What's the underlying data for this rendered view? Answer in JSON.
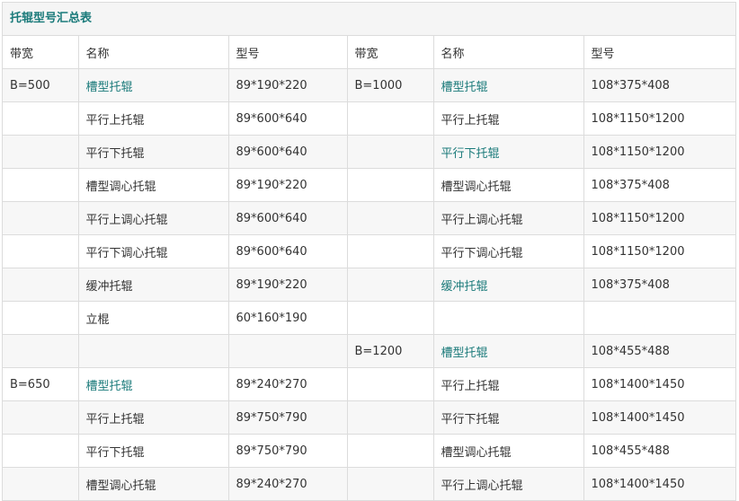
{
  "title": "托辊型号汇总表",
  "headers": [
    "带宽",
    "名称",
    "型号",
    "带宽",
    "名称",
    "型号"
  ],
  "rows": [
    [
      {
        "t": "B=500"
      },
      {
        "t": "槽型托辊",
        "link": true
      },
      {
        "t": "89*190*220"
      },
      {
        "t": "B=1000"
      },
      {
        "t": "槽型托辊",
        "link": true
      },
      {
        "t": "108*375*408"
      }
    ],
    [
      {
        "t": ""
      },
      {
        "t": "平行上托辊"
      },
      {
        "t": "89*600*640"
      },
      {
        "t": ""
      },
      {
        "t": "平行上托辊"
      },
      {
        "t": "108*1150*1200"
      }
    ],
    [
      {
        "t": ""
      },
      {
        "t": "平行下托辊"
      },
      {
        "t": "89*600*640"
      },
      {
        "t": ""
      },
      {
        "t": "平行下托辊",
        "link": true
      },
      {
        "t": "108*1150*1200"
      }
    ],
    [
      {
        "t": ""
      },
      {
        "t": "槽型调心托辊"
      },
      {
        "t": "89*190*220"
      },
      {
        "t": ""
      },
      {
        "t": "槽型调心托辊"
      },
      {
        "t": "108*375*408"
      }
    ],
    [
      {
        "t": ""
      },
      {
        "t": "平行上调心托辊"
      },
      {
        "t": "89*600*640"
      },
      {
        "t": ""
      },
      {
        "t": "平行上调心托辊"
      },
      {
        "t": "108*1150*1200"
      }
    ],
    [
      {
        "t": ""
      },
      {
        "t": "平行下调心托辊"
      },
      {
        "t": "89*600*640"
      },
      {
        "t": ""
      },
      {
        "t": "平行下调心托辊"
      },
      {
        "t": "108*1150*1200"
      }
    ],
    [
      {
        "t": ""
      },
      {
        "t": "缓冲托辊"
      },
      {
        "t": "89*190*220"
      },
      {
        "t": ""
      },
      {
        "t": "缓冲托辊",
        "link": true
      },
      {
        "t": "108*375*408"
      }
    ],
    [
      {
        "t": ""
      },
      {
        "t": "立棍"
      },
      {
        "t": "60*160*190"
      },
      {
        "t": ""
      },
      {
        "t": ""
      },
      {
        "t": ""
      }
    ],
    [
      {
        "t": ""
      },
      {
        "t": ""
      },
      {
        "t": ""
      },
      {
        "t": "B=1200"
      },
      {
        "t": "槽型托辊",
        "link": true
      },
      {
        "t": "108*455*488"
      }
    ],
    [
      {
        "t": "B=650"
      },
      {
        "t": "槽型托辊",
        "link": true
      },
      {
        "t": "89*240*270"
      },
      {
        "t": ""
      },
      {
        "t": "平行上托辊"
      },
      {
        "t": "108*1400*1450"
      }
    ],
    [
      {
        "t": ""
      },
      {
        "t": "平行上托辊"
      },
      {
        "t": "89*750*790"
      },
      {
        "t": ""
      },
      {
        "t": "平行下托辊"
      },
      {
        "t": "108*1400*1450"
      }
    ],
    [
      {
        "t": ""
      },
      {
        "t": "平行下托辊"
      },
      {
        "t": "89*750*790"
      },
      {
        "t": ""
      },
      {
        "t": "槽型调心托辊"
      },
      {
        "t": "108*455*488"
      }
    ],
    [
      {
        "t": ""
      },
      {
        "t": "槽型调心托辊"
      },
      {
        "t": "89*240*270"
      },
      {
        "t": ""
      },
      {
        "t": "平行上调心托辊"
      },
      {
        "t": "108*1400*1450"
      }
    ]
  ]
}
